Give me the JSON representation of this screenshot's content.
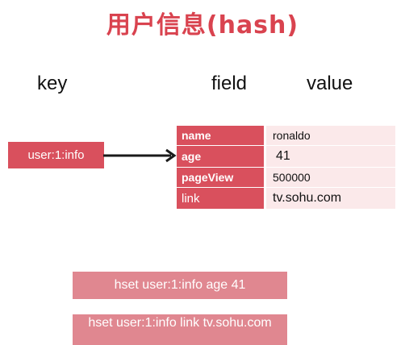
{
  "title": "用户信息(hash)",
  "labels": {
    "key": "key",
    "field": "field",
    "value": "value"
  },
  "key": "user:1:info",
  "hash": [
    {
      "field": "name",
      "value": "ronaldo"
    },
    {
      "field": "age",
      "value": "41"
    },
    {
      "field": "pageView",
      "value": "500000"
    },
    {
      "field": "link",
      "value": "tv.sohu.com"
    }
  ],
  "commands": [
    "hset user:1:info age 41",
    "hset user:1:info link tv.sohu.com"
  ],
  "colors": {
    "title": "#d9434f",
    "field_bg": "#d9505d",
    "value_bg": "#fbe9ea",
    "command_bg": "#e08790"
  }
}
